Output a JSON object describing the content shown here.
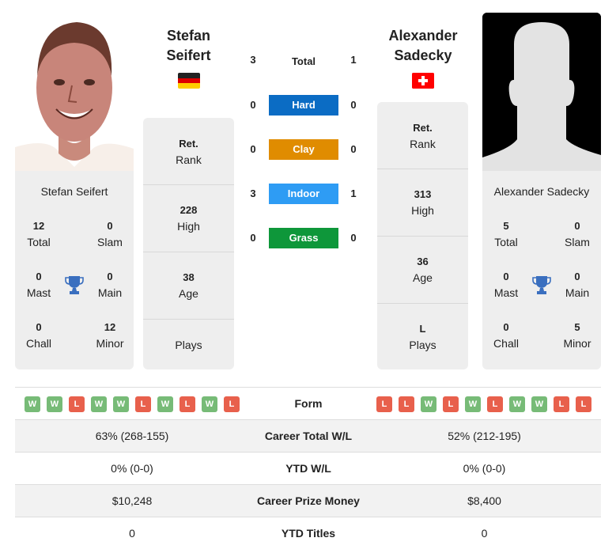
{
  "player1": {
    "name_line1": "Stefan",
    "name_line2": "Seifert",
    "full_name": "Stefan Seifert",
    "flag": "germany-flag",
    "photo": "player-photo",
    "titles": {
      "total": "12",
      "total_label": "Total",
      "slam": "0",
      "slam_label": "Slam",
      "mast": "0",
      "mast_label": "Mast",
      "main": "0",
      "main_label": "Main",
      "chall": "0",
      "chall_label": "Chall",
      "minor": "12",
      "minor_label": "Minor"
    },
    "rank": {
      "value": "Ret.",
      "label": "Rank"
    },
    "high": {
      "value": "228",
      "label": "High"
    },
    "age": {
      "value": "38",
      "label": "Age"
    },
    "plays": {
      "value": "",
      "label": "Plays"
    },
    "form": [
      "W",
      "W",
      "L",
      "W",
      "W",
      "L",
      "W",
      "L",
      "W",
      "L"
    ]
  },
  "player2": {
    "name_line1": "Alexander",
    "name_line2": "Sadecky",
    "full_name": "Alexander Sadecky",
    "flag": "switzerland-flag",
    "photo": "silhouette-placeholder",
    "titles": {
      "total": "5",
      "total_label": "Total",
      "slam": "0",
      "slam_label": "Slam",
      "mast": "0",
      "mast_label": "Mast",
      "main": "0",
      "main_label": "Main",
      "chall": "0",
      "chall_label": "Chall",
      "minor": "5",
      "minor_label": "Minor"
    },
    "rank": {
      "value": "Ret.",
      "label": "Rank"
    },
    "high": {
      "value": "313",
      "label": "High"
    },
    "age": {
      "value": "36",
      "label": "Age"
    },
    "plays": {
      "value": "L",
      "label": "Plays"
    },
    "form": [
      "L",
      "L",
      "W",
      "L",
      "W",
      "L",
      "W",
      "W",
      "L",
      "L"
    ]
  },
  "h2h": {
    "total": {
      "label": "Total",
      "p1": "3",
      "p2": "1"
    },
    "surfaces": [
      {
        "label": "Hard",
        "p1": "0",
        "p2": "0",
        "color": "#0b6cc4"
      },
      {
        "label": "Clay",
        "p1": "0",
        "p2": "0",
        "color": "#e08c00"
      },
      {
        "label": "Indoor",
        "p1": "3",
        "p2": "1",
        "color": "#2e9cf4"
      },
      {
        "label": "Grass",
        "p1": "0",
        "p2": "0",
        "color": "#0e973a"
      }
    ]
  },
  "table": {
    "form_label": "Form",
    "rows": [
      {
        "label": "Career Total W/L",
        "p1": "63% (268-155)",
        "p2": "52% (212-195)"
      },
      {
        "label": "YTD W/L",
        "p1": "0% (0-0)",
        "p2": "0% (0-0)"
      },
      {
        "label": "Career Prize Money",
        "p1": "$10,248",
        "p2": "$8,400"
      },
      {
        "label": "YTD Titles",
        "p1": "0",
        "p2": "0"
      }
    ]
  },
  "colors": {
    "win": "#77bb77",
    "loss": "#e8604c",
    "trophy": "#3a6fbf",
    "card_bg": "#eeeeee"
  }
}
